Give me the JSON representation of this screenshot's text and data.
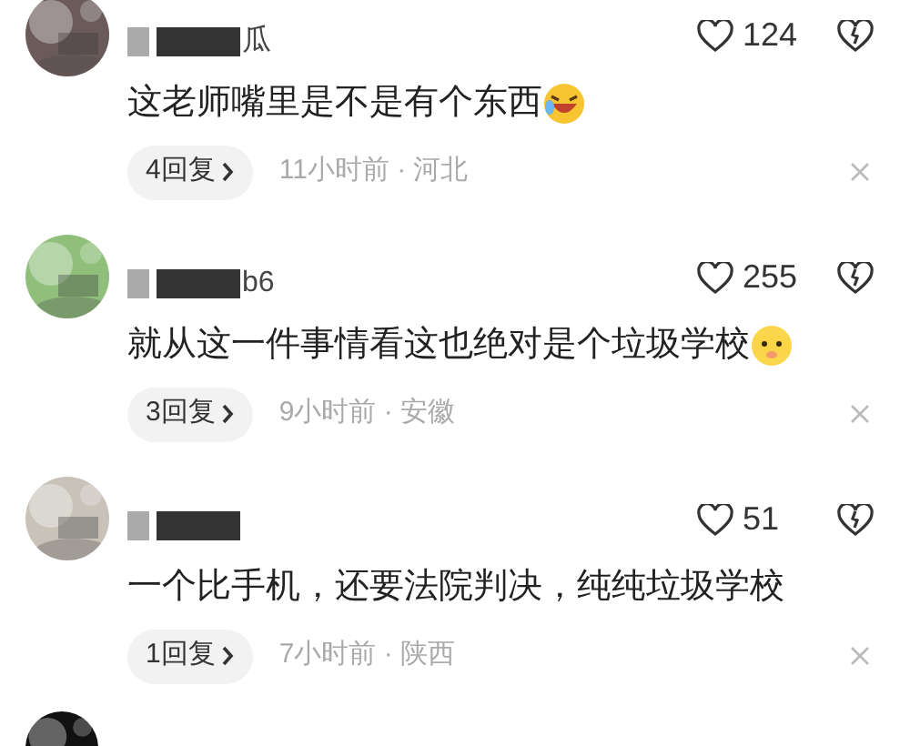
{
  "comments": [
    {
      "name_visible": "瓜",
      "likes": "124",
      "text": "这老师嘴里是不是有个东西",
      "emoji": true,
      "replies": "4回复",
      "meta": "11小时前 · 河北"
    },
    {
      "name_visible": "b6",
      "likes": "255",
      "text": "就从这一件事情看这也绝对是个垃圾学校",
      "emoji": true,
      "replies": "3回复",
      "meta": "9小时前 · 安徽"
    },
    {
      "likes": "51",
      "text": "一个比手机，还要法院判决，纯纯垃圾学校",
      "emoji": false,
      "replies": "1回复",
      "meta": "7小时前 · 陕西"
    }
  ]
}
